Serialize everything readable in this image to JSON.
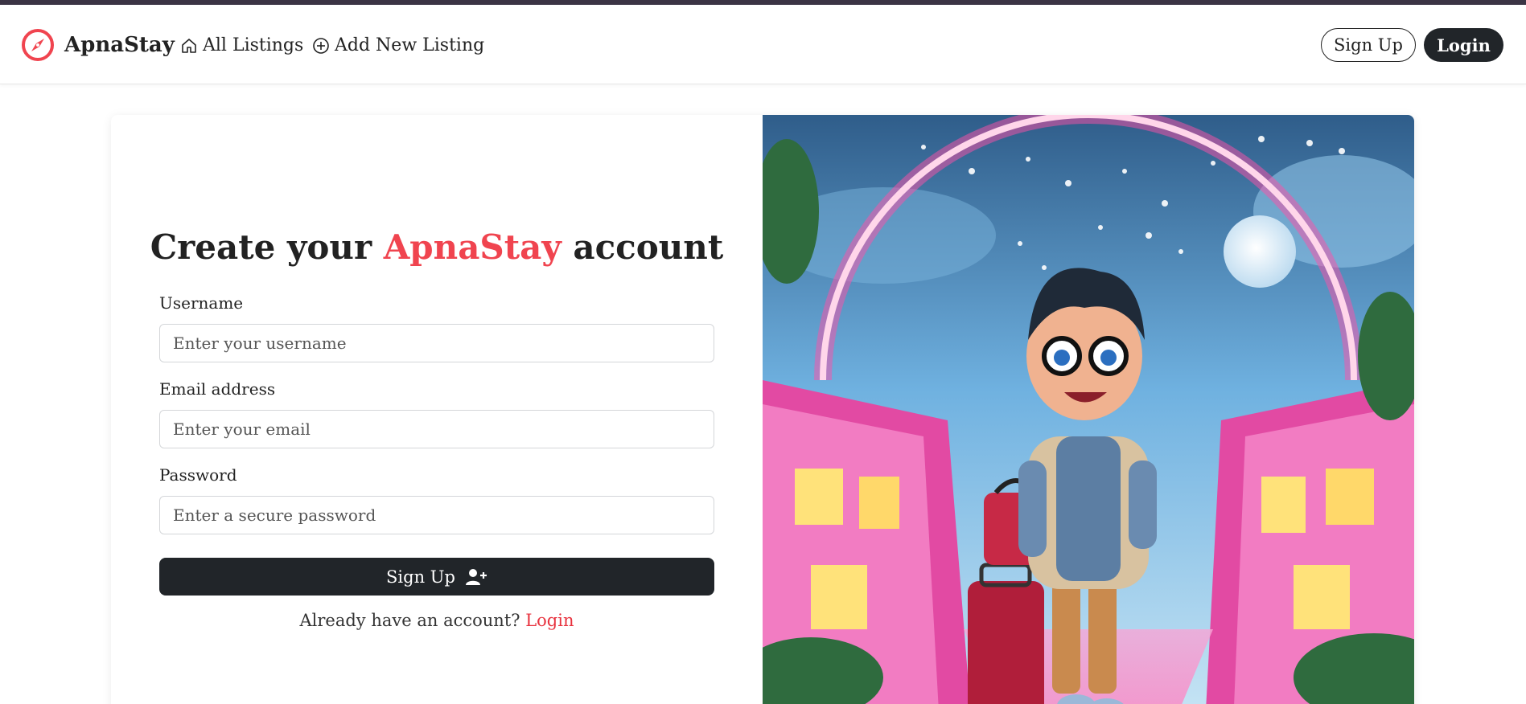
{
  "nav": {
    "brand": "ApnaStay",
    "links": [
      {
        "label": "All Listings",
        "icon": "home-icon"
      },
      {
        "label": "Add New Listing",
        "icon": "plus-circle-icon"
      }
    ],
    "signup_label": "Sign Up",
    "login_label": "Login"
  },
  "form": {
    "title_pre": "Create your ",
    "title_brand": "ApnaStay",
    "title_post": " account",
    "username_label": "Username",
    "username_placeholder": "Enter your username",
    "email_label": "Email address",
    "email_placeholder": "Enter your email",
    "password_label": "Password",
    "password_placeholder": "Enter a secure password",
    "submit_label": "Sign Up",
    "submit_icon": "user-plus-icon",
    "switch_text": "Already have an account? ",
    "switch_link": "Login"
  },
  "colors": {
    "accent": "#f0444f",
    "dark": "#212529",
    "topbar": "#3b3444"
  }
}
